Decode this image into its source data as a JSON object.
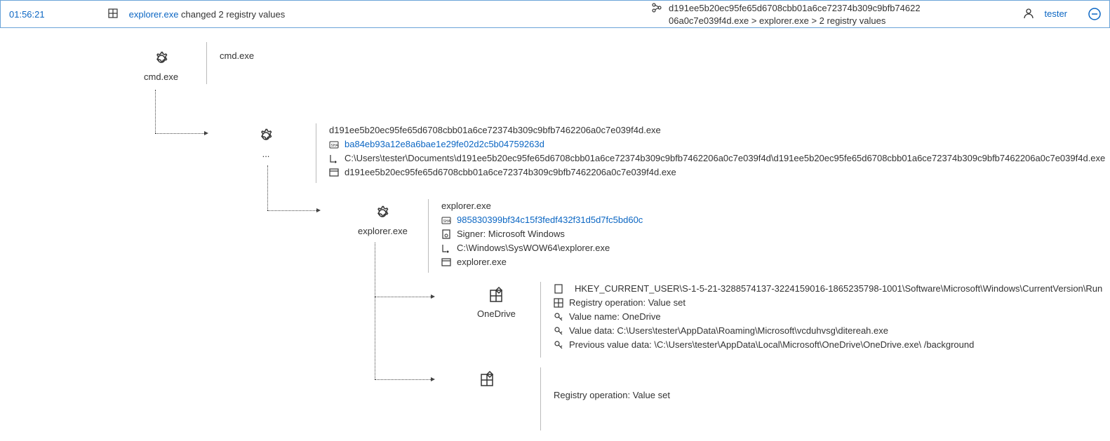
{
  "header": {
    "timestamp": "01:56:21",
    "process_link": "explorer.exe",
    "summary_suffix": " changed 2 registry values",
    "hash_line1": "d191ee5b20ec95fe65d6708cbb01a6ce72374b309c9bfb74622",
    "hash_line2": "06a0c7e039f4d.exe  >  explorer.exe  >  2 registry values",
    "user": "tester"
  },
  "cmd_block": {
    "label": "cmd.exe",
    "title": "cmd.exe"
  },
  "payload_block": {
    "label": "...",
    "exe_name": "d191ee5b20ec95fe65d6708cbb01a6ce72374b309c9bfb7462206a0c7e039f4d.exe",
    "sha_label": "SHA1",
    "sha_hash": "ba84eb93a12e8a6bae1e29fe02d2c5b04759263d",
    "path": "C:\\Users\\tester\\Documents\\d191ee5b20ec95fe65d6708cbb01a6ce72374b309c9bfb7462206a0c7e039f4d\\d191ee5b20ec95fe65d6708cbb01a6ce72374b309c9bfb7462206a0c7e039f4d.exe",
    "window": "d191ee5b20ec95fe65d6708cbb01a6ce72374b309c9bfb7462206a0c7e039f4d.exe"
  },
  "explorer_block": {
    "label": "explorer.exe",
    "title": "explorer.exe",
    "sha_label": "SHA1",
    "sha_hash": "985830399bf34c15f3fedf432f31d5d7fc5bd60c",
    "signer": "Signer: Microsoft Windows",
    "path": "C:\\Windows\\SysWOW64\\explorer.exe",
    "window": "explorer.exe"
  },
  "reg1": {
    "label": "OneDrive",
    "key": "HKEY_CURRENT_USER\\S-1-5-21-3288574137-3224159016-1865235798-1001\\Software\\Microsoft\\Windows\\CurrentVersion\\Run",
    "op": "Registry operation: Value set",
    "name": "Value name: OneDrive",
    "data": "Value data: C:\\Users\\tester\\AppData\\Roaming\\Microsoft\\vcduhvsg\\ditereah.exe",
    "prev": "Previous value data: \\C:\\Users\\tester\\AppData\\Local\\Microsoft\\OneDrive\\OneDrive.exe\\ /background"
  },
  "reg2": {
    "op": "Registry operation: Value set"
  }
}
